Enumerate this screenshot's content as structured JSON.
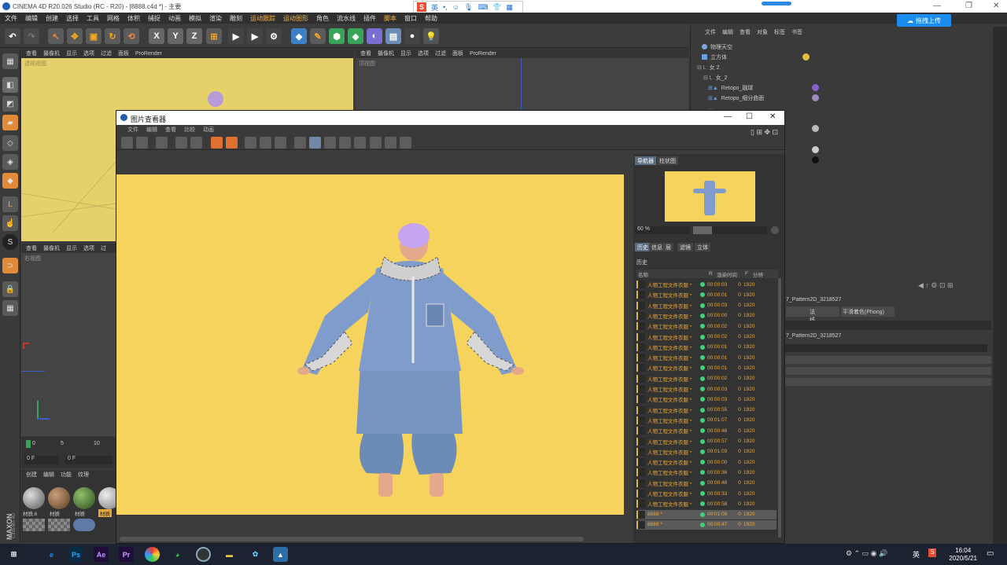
{
  "app": {
    "title": "CINEMA 4D R20.026 Studio (RC - R20) - [8888.c4d *] - 主要"
  },
  "ime": {
    "label": "英"
  },
  "menubar": [
    "文件",
    "编辑",
    "创建",
    "选择",
    "工具",
    "网格",
    "体积",
    "捕捉",
    "动画",
    "模拟",
    "渲染",
    "雕刻",
    "运动跟踪",
    "运动图形",
    "角色",
    "流水线",
    "插件",
    "脚本",
    "窗口",
    "帮助"
  ],
  "toolbar_icons": [
    "undo-icon",
    "redo-icon",
    "select-icon",
    "move-icon",
    "scale-icon",
    "rotate-icon",
    "live-select-icon",
    "x-axis-icon",
    "y-axis-icon",
    "z-axis-icon",
    "coord-icon",
    "render-view-icon",
    "render-picture-icon",
    "render-settings-icon",
    "cube-icon",
    "pen-icon",
    "subdiv-icon",
    "cloner-icon",
    "deformer-icon",
    "floor-icon",
    "camera-icon",
    "light-icon"
  ],
  "axis_labels": {
    "x": "X",
    "y": "Y",
    "z": "Z"
  },
  "viewport_tl": {
    "tabs": [
      "查看",
      "摄像机",
      "显示",
      "选项",
      "过滤",
      "面板",
      "ProRender"
    ],
    "name": "透视视图"
  },
  "viewport_tr": {
    "tabs": [
      "查看",
      "摄像机",
      "显示",
      "选项",
      "过滤",
      "面板",
      "ProRender"
    ],
    "name": "顶视图"
  },
  "viewport_bl": {
    "tabs": [
      "查看",
      "摄像机",
      "显示",
      "选项",
      "过"
    ],
    "name": "右视图"
  },
  "timeline": {
    "ticks": [
      "0",
      "5",
      "10"
    ],
    "frame1": "0 F",
    "frame2": "0 F"
  },
  "materials": {
    "tabs": [
      "创建",
      "编辑",
      "功能",
      "纹理"
    ],
    "items": [
      "材质.6",
      "材质",
      "材质",
      "材质"
    ]
  },
  "objmgr": {
    "tabs": [
      "文件",
      "编辑",
      "查看",
      "对象",
      "标签",
      "书签"
    ],
    "objects": [
      "物理天空",
      "立方体",
      "女 2",
      "女_2",
      "Retopo_融球",
      "Retopo_细分曲面",
      "..."
    ]
  },
  "upload": {
    "label": "拖拽上传"
  },
  "attr": {
    "pattern1": "7_Pattern2D_3218527",
    "btn1": "法线",
    "btn2": "平滑着色(Phong)",
    "pattern2": "7_Pattern2D_3218527"
  },
  "viewer": {
    "title": "图片查看器",
    "menu": [
      "文件",
      "编辑",
      "查看",
      "比较",
      "动画"
    ],
    "nav_tabs": [
      "导航器",
      "柱状图"
    ],
    "zoom": "60 %",
    "hist_tabs": [
      "历史",
      "信息",
      "层",
      "滤镜",
      "立体"
    ],
    "hist_title": "历史",
    "hist_cols": [
      "名称",
      "R",
      "渲染时间",
      "F",
      "分辨"
    ],
    "history": [
      {
        "name": "人物工程文件衣服 *",
        "time": "00:00:03",
        "f": "0",
        "res": "1920"
      },
      {
        "name": "人物工程文件衣服 *",
        "time": "00:00:01",
        "f": "0",
        "res": "1920"
      },
      {
        "name": "人物工程文件衣服 *",
        "time": "00:00:03",
        "f": "0",
        "res": "1920"
      },
      {
        "name": "人物工程文件衣服 *",
        "time": "00:00:00",
        "f": "0",
        "res": "1920"
      },
      {
        "name": "人物工程文件衣服 *",
        "time": "00:00:02",
        "f": "0",
        "res": "1920"
      },
      {
        "name": "人物工程文件衣服 *",
        "time": "00:00:02",
        "f": "0",
        "res": "1920"
      },
      {
        "name": "人物工程文件衣服 *",
        "time": "00:00:01",
        "f": "0",
        "res": "1920"
      },
      {
        "name": "人物工程文件衣服 *",
        "time": "00:00:01",
        "f": "0",
        "res": "1920"
      },
      {
        "name": "人物工程文件衣服 *",
        "time": "00:00:01",
        "f": "0",
        "res": "1920"
      },
      {
        "name": "人物工程文件衣服 *",
        "time": "00:00:02",
        "f": "0",
        "res": "1920"
      },
      {
        "name": "人物工程文件衣服 *",
        "time": "00:00:03",
        "f": "0",
        "res": "1920"
      },
      {
        "name": "人物工程文件衣服 *",
        "time": "00:00:03",
        "f": "0",
        "res": "1920"
      },
      {
        "name": "人物工程文件衣服 *",
        "time": "00:00:55",
        "f": "0",
        "res": "1920"
      },
      {
        "name": "人物工程文件衣服 *",
        "time": "00:01:07",
        "f": "0",
        "res": "1920"
      },
      {
        "name": "人物工程文件衣服 *",
        "time": "00:00:48",
        "f": "0",
        "res": "1920"
      },
      {
        "name": "人物工程文件衣服 *",
        "time": "00:00:57",
        "f": "0",
        "res": "1920"
      },
      {
        "name": "人物工程文件衣服 *",
        "time": "00:01:03",
        "f": "0",
        "res": "1920"
      },
      {
        "name": "人物工程文件衣服 *",
        "time": "00:00:00",
        "f": "0",
        "res": "1920"
      },
      {
        "name": "人物工程文件衣服 *",
        "time": "00:00:36",
        "f": "0",
        "res": "1920"
      },
      {
        "name": "人物工程文件衣服 *",
        "time": "00:00:48",
        "f": "0",
        "res": "1920"
      },
      {
        "name": "人物工程文件衣服 *",
        "time": "00:00:33",
        "f": "0",
        "res": "1920"
      },
      {
        "name": "人物工程文件衣服 *",
        "time": "00:00:58",
        "f": "0",
        "res": "1920"
      },
      {
        "name": "8888 *",
        "time": "00:01:09",
        "f": "0",
        "res": "1920"
      },
      {
        "name": "8888 *",
        "time": "00:00:47",
        "f": "0",
        "res": "1920"
      }
    ]
  },
  "taskbar": {
    "time": "16:04",
    "date": "2020/5/21",
    "lang": "英"
  },
  "branding": {
    "maxon": "MAXON",
    "c4d": "CINEMA 4D"
  }
}
